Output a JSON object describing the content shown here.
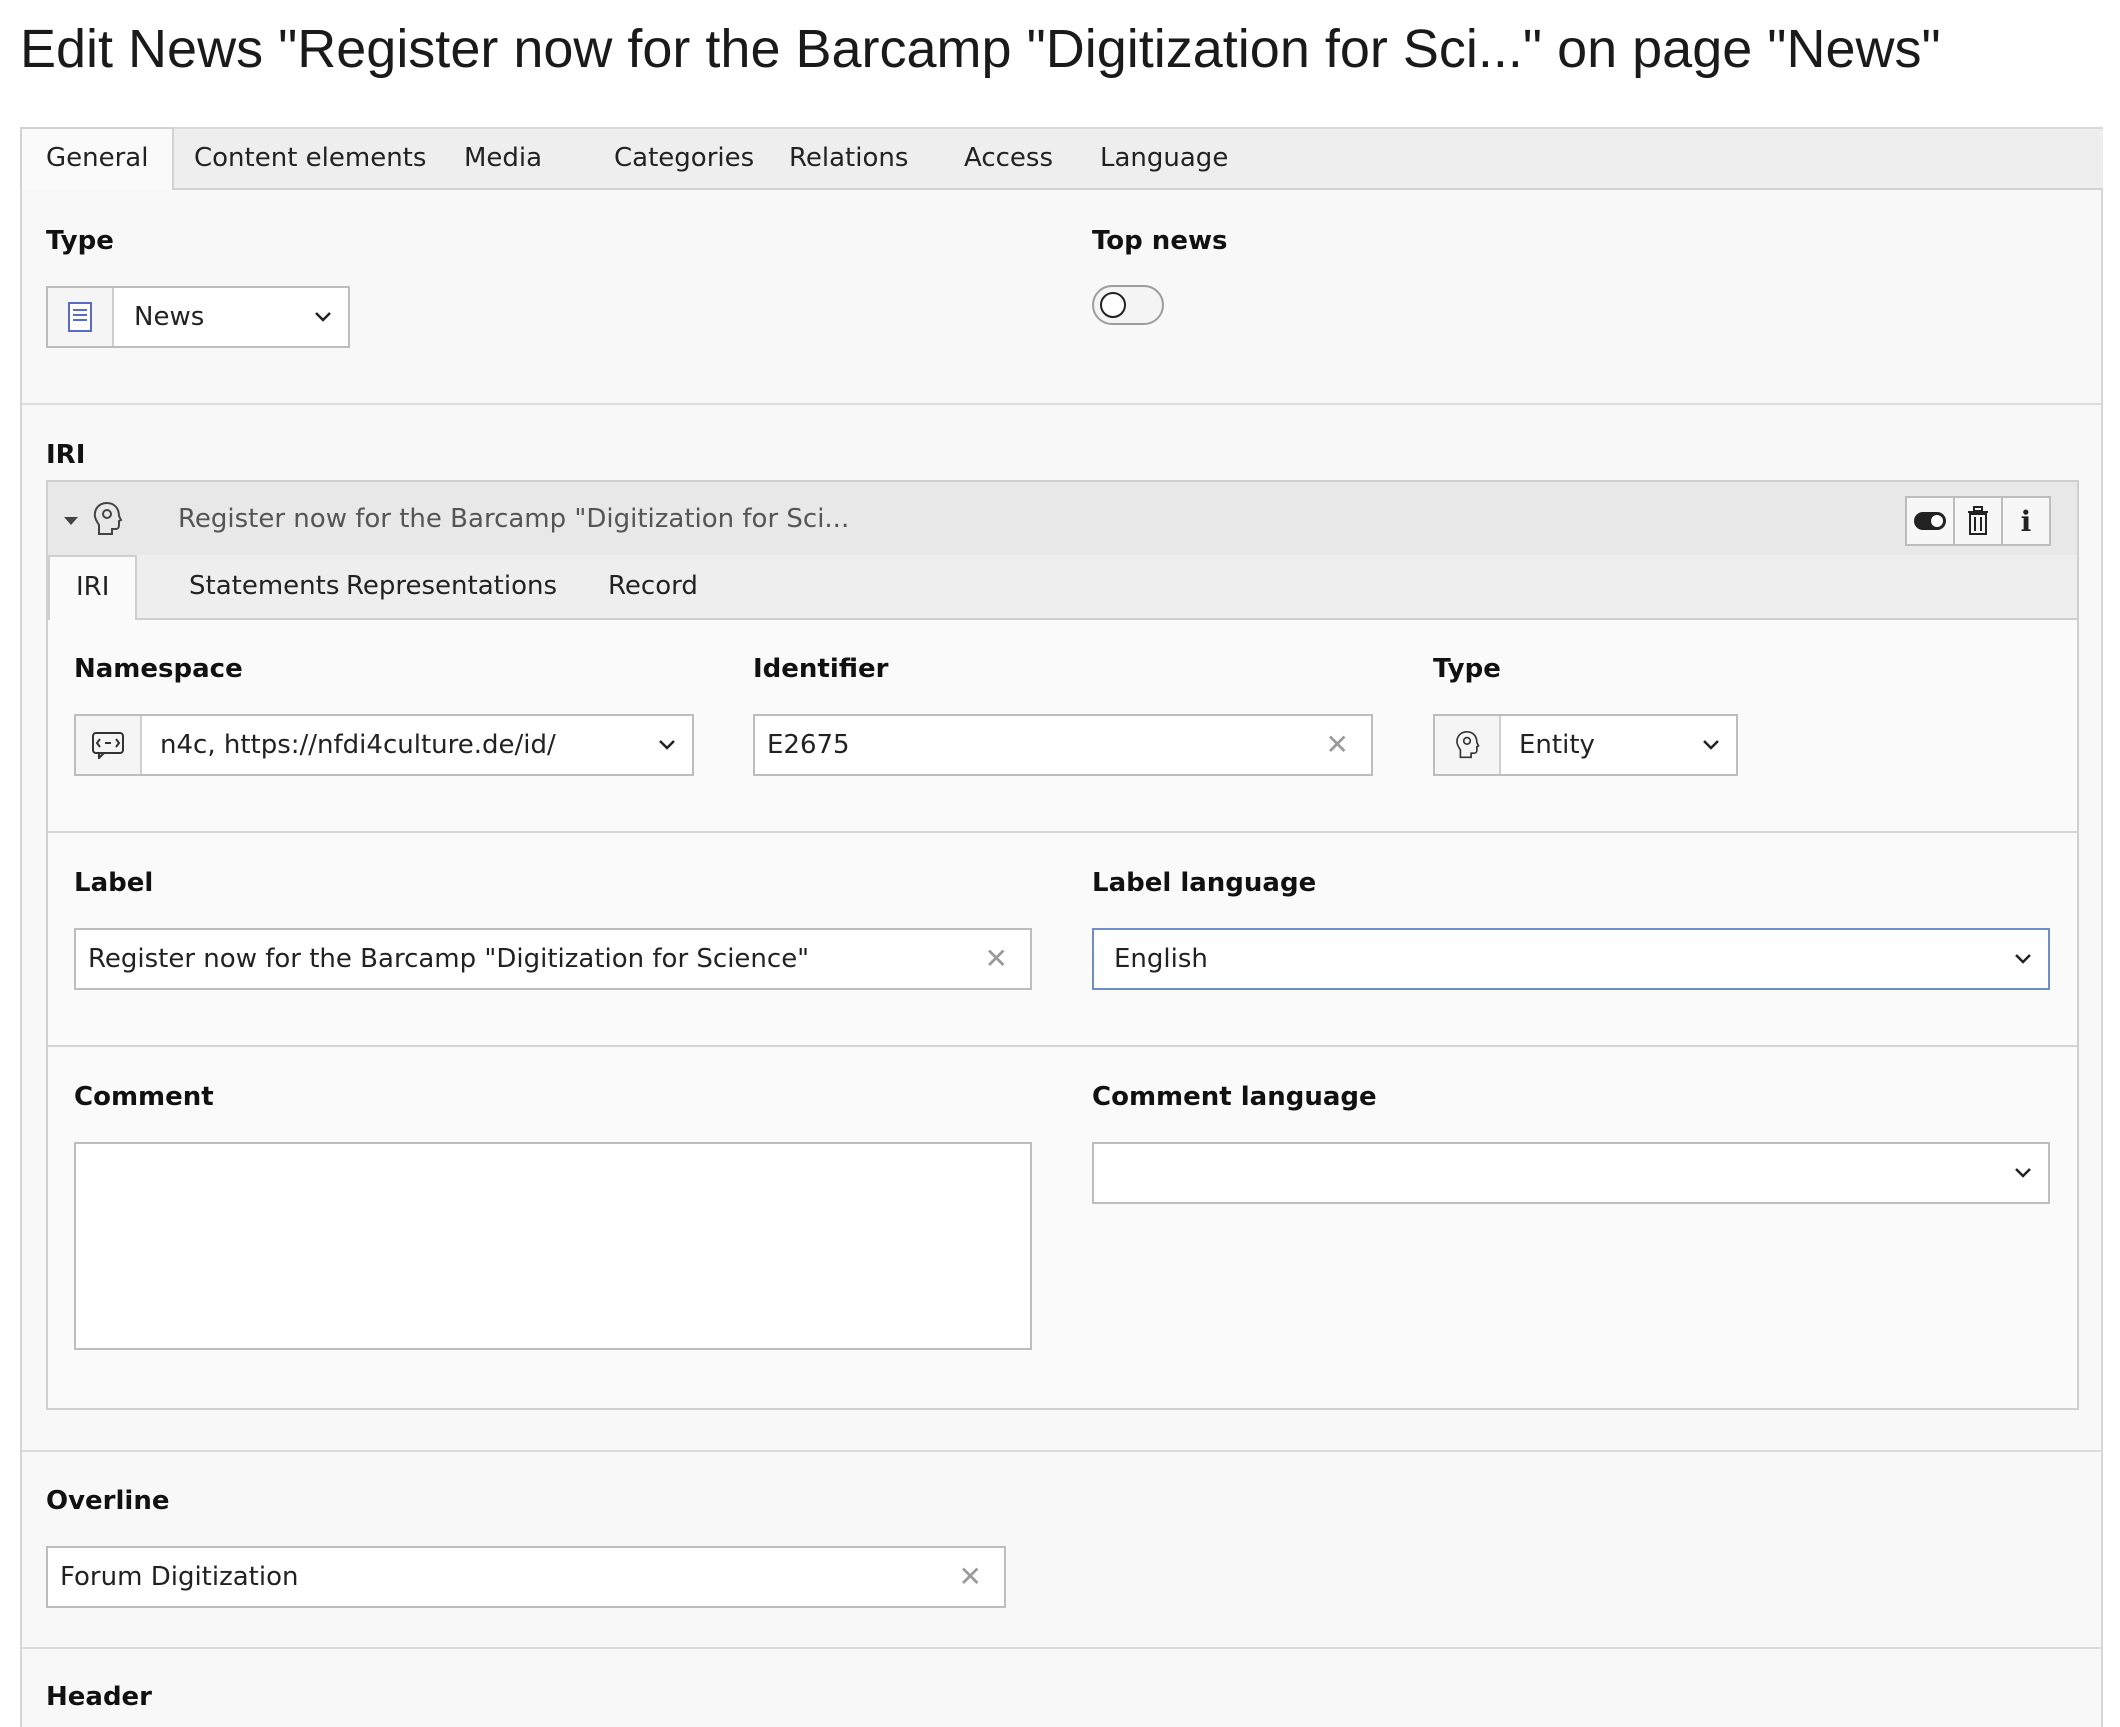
{
  "page": {
    "title": "Edit News \"Register now for the Barcamp \"Digitization for Sci...\" on page \"News\""
  },
  "tabs": [
    "General",
    "Content elements",
    "Media",
    "Categories",
    "Relations",
    "Access",
    "Language"
  ],
  "general": {
    "type_label": "Type",
    "type_value": "News",
    "top_news_label": "Top news",
    "top_news_on": false
  },
  "iri": {
    "section_label": "IRI",
    "panel_title": "Register now for the Barcamp \"Digitization for Sci...",
    "subtabs": [
      "IRI",
      "Statements",
      "Representations",
      "Record"
    ],
    "namespace_label": "Namespace",
    "namespace_value": "n4c, https://nfdi4culture.de/id/",
    "identifier_label": "Identifier",
    "identifier_value": "E2675",
    "type_label": "Type",
    "type_value": "Entity",
    "label_label": "Label",
    "label_value": "Register now for the Barcamp \"Digitization for Science\"",
    "label_language_label": "Label language",
    "label_language_value": "English",
    "comment_label": "Comment",
    "comment_value": "",
    "comment_language_label": "Comment language",
    "comment_language_value": ""
  },
  "overline": {
    "label": "Overline",
    "value": "Forum Digitization"
  },
  "header": {
    "label": "Header"
  },
  "colors": {
    "focus_border": "#6d8ec7",
    "icon_accent": "#5b6ac4"
  }
}
